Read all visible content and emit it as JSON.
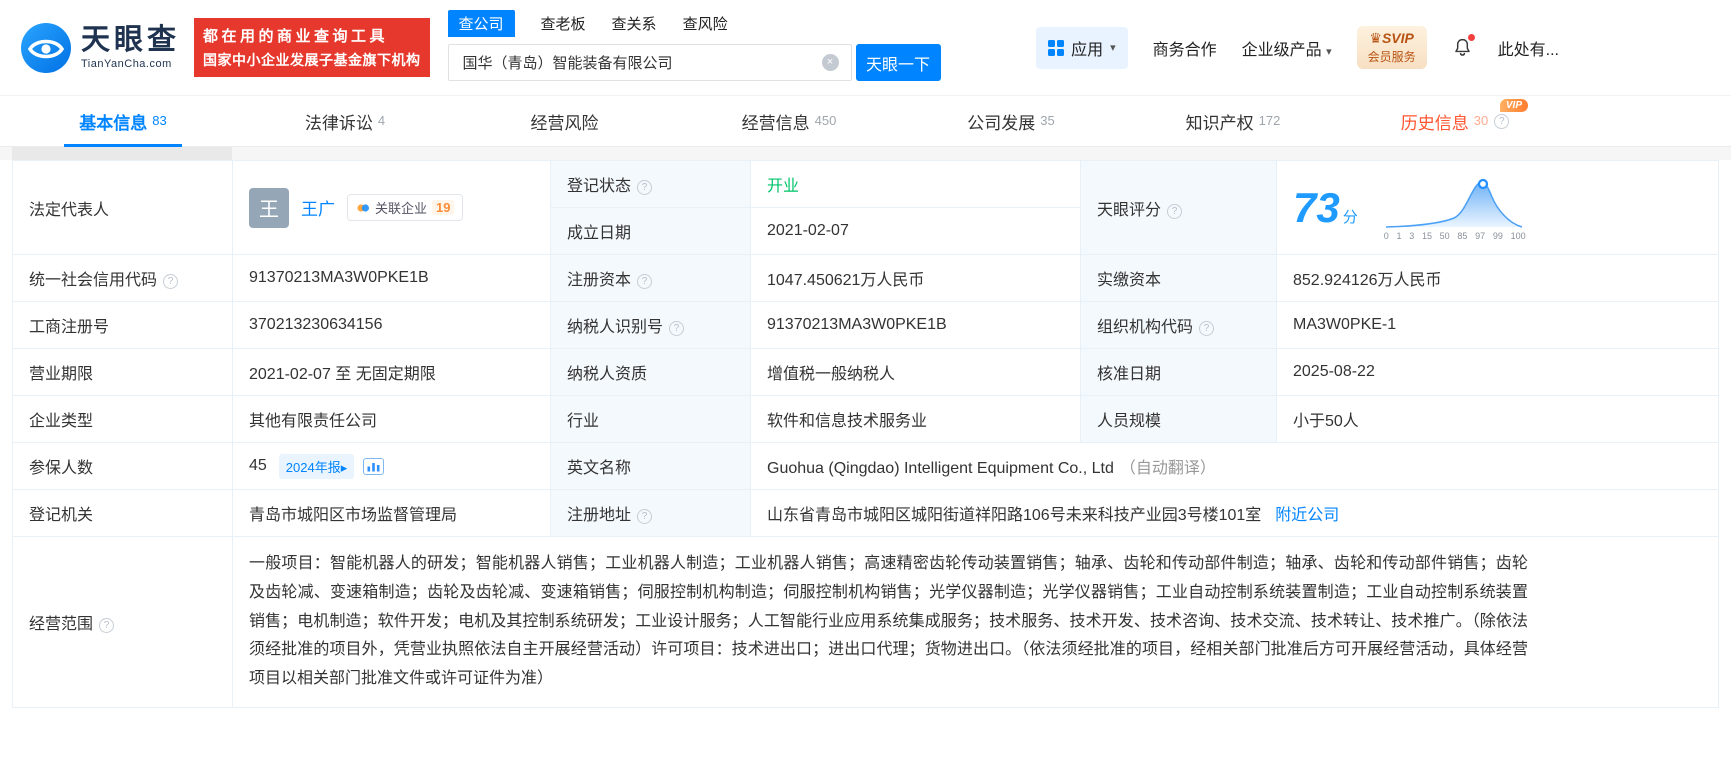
{
  "colors": {
    "brand_blue": "#0084ff",
    "banner_red": "#e6382c",
    "status_green": "#00c46a",
    "vip_orange": "#ff8c37",
    "history_orange_red": "#ff5630"
  },
  "icons": {
    "help": "?",
    "caret_down": "▾",
    "clear": "×",
    "crown": "♛",
    "arrow_right": "▸"
  },
  "header": {
    "logo": {
      "brand": "天眼查",
      "domain": "TianYanCha.com"
    },
    "banner": {
      "line1": "都在用的商业查询工具",
      "line2": "国家中小企业发展子基金旗下机构"
    },
    "search": {
      "tabs": [
        {
          "label": "查公司"
        },
        {
          "label": "查老板"
        },
        {
          "label": "查关系"
        },
        {
          "label": "查风险"
        }
      ],
      "value": "国华（青岛）智能装备有限公司",
      "button": "天眼一下"
    },
    "menu": {
      "apps": "应用",
      "business": "商务合作",
      "enterprise": "企业级产品",
      "svip_line1": "SVIP",
      "svip_line2": "会员服务",
      "more": "此处有..."
    }
  },
  "nav": {
    "vip_label": "VIP",
    "tabs": [
      {
        "label": "基本信息",
        "count": "83"
      },
      {
        "label": "法律诉讼",
        "count": "4"
      },
      {
        "label": "经营风险",
        "count": ""
      },
      {
        "label": "经营信息",
        "count": "450"
      },
      {
        "label": "公司发展",
        "count": "35"
      },
      {
        "label": "知识产权",
        "count": "172"
      },
      {
        "label": "历史信息",
        "count": "30"
      }
    ]
  },
  "info": {
    "legal_rep": {
      "label": "法定代表人",
      "avatar": "王",
      "name": "王广",
      "badge_label": "关联企业",
      "badge_count": "19"
    },
    "reg_status": {
      "label": "登记状态",
      "value": "开业"
    },
    "est_date": {
      "label": "成立日期",
      "value": "2021-02-07"
    },
    "score": {
      "label": "天眼评分",
      "value": "73",
      "unit": "分",
      "ticks": [
        "0",
        "1",
        "3",
        "15",
        "50",
        "85",
        "97",
        "99",
        "100"
      ]
    },
    "credit_code": {
      "label": "统一社会信用代码",
      "value": "91370213MA3W0PKE1B"
    },
    "reg_capital": {
      "label": "注册资本",
      "value": "1047.450621万人民币"
    },
    "paid_capital": {
      "label": "实缴资本",
      "value": "852.924126万人民币"
    },
    "reg_no": {
      "label": "工商注册号",
      "value": "370213230634156"
    },
    "tax_id": {
      "label": "纳税人识别号",
      "value": "91370213MA3W0PKE1B"
    },
    "org_code": {
      "label": "组织机构代码",
      "value": "MA3W0PKE-1"
    },
    "term": {
      "label": "营业期限",
      "value": "2021-02-07 至 无固定期限"
    },
    "tax_quality": {
      "label": "纳税人资质",
      "value": "增值税一般纳税人"
    },
    "approval": {
      "label": "核准日期",
      "value": "2025-08-22"
    },
    "type": {
      "label": "企业类型",
      "value": "其他有限责任公司"
    },
    "industry": {
      "label": "行业",
      "value": "软件和信息技术服务业"
    },
    "staff": {
      "label": "人员规模",
      "value": "小于50人"
    },
    "insured": {
      "label": "参保人数",
      "value": "45",
      "badge": "2024年报"
    },
    "en_name": {
      "label": "英文名称",
      "value": "Guohua (Qingdao) Intelligent Equipment Co., Ltd",
      "note": "（自动翻译）"
    },
    "authority": {
      "label": "登记机关",
      "value": "青岛市城阳区市场监督管理局"
    },
    "address": {
      "label": "注册地址",
      "value": "山东省青岛市城阳区城阳街道祥阳路106号未来科技产业园3号楼101室",
      "link": "附近公司"
    },
    "scope": {
      "label": "经营范围",
      "value": "一般项目：智能机器人的研发；智能机器人销售；工业机器人制造；工业机器人销售；高速精密齿轮传动装置销售；轴承、齿轮和传动部件制造；轴承、齿轮和传动部件销售；齿轮及齿轮减、变速箱制造；齿轮及齿轮减、变速箱销售；伺服控制机构制造；伺服控制机构销售；光学仪器制造；光学仪器销售；工业自动控制系统装置制造；工业自动控制系统装置销售；电机制造；软件开发；电机及其控制系统研发；工业设计服务；人工智能行业应用系统集成服务；技术服务、技术开发、技术咨询、技术交流、技术转让、技术推广。（除依法须经批准的项目外，凭营业执照依法自主开展经营活动）许可项目：技术进出口；进出口代理；货物进出口。（依法须经批准的项目，经相关部门批准后方可开展经营活动，具体经营项目以相关部门批准文件或许可证件为准）"
    }
  }
}
